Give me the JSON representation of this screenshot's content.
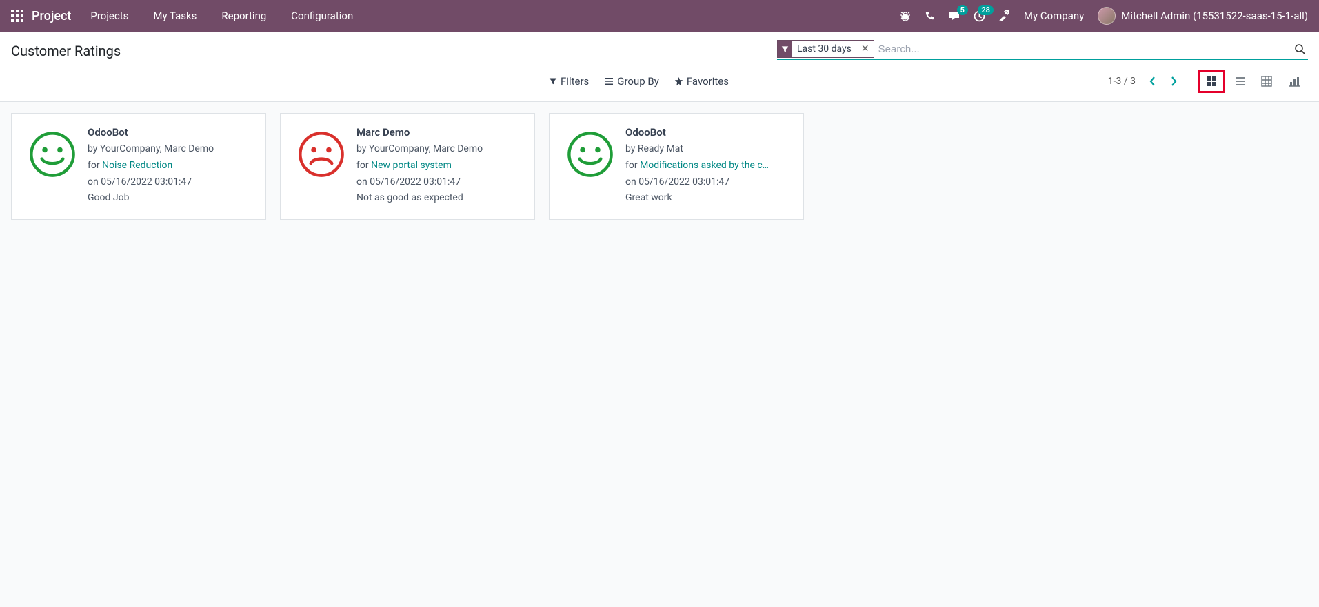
{
  "nav": {
    "brand": "Project",
    "menu": [
      "Projects",
      "My Tasks",
      "Reporting",
      "Configuration"
    ],
    "messages_badge": "5",
    "activities_badge": "28",
    "company": "My Company",
    "user": "Mitchell Admin (15531522-saas-15-1-all)"
  },
  "page": {
    "title": "Customer Ratings",
    "filter_tag": "Last 30 days",
    "search_placeholder": "Search...",
    "filters_label": "Filters",
    "groupby_label": "Group By",
    "favorites_label": "Favorites",
    "pager": "1-3 / 3"
  },
  "cards": [
    {
      "mood": "happy",
      "title": "OdooBot",
      "by": "by YourCompany, Marc Demo",
      "for_prefix": "for ",
      "for_link": "Noise Reduction",
      "on": "on 05/16/2022 03:01:47",
      "comment": "Good Job"
    },
    {
      "mood": "sad",
      "title": "Marc Demo",
      "by": "by YourCompany, Marc Demo",
      "for_prefix": "for ",
      "for_link": "New portal system",
      "on": "on 05/16/2022 03:01:47",
      "comment": "Not as good as expected"
    },
    {
      "mood": "happy",
      "title": "OdooBot",
      "by": "by Ready Mat",
      "for_prefix": "for ",
      "for_link": "Modifications asked by the c…",
      "on": "on 05/16/2022 03:01:47",
      "comment": "Great work"
    }
  ]
}
